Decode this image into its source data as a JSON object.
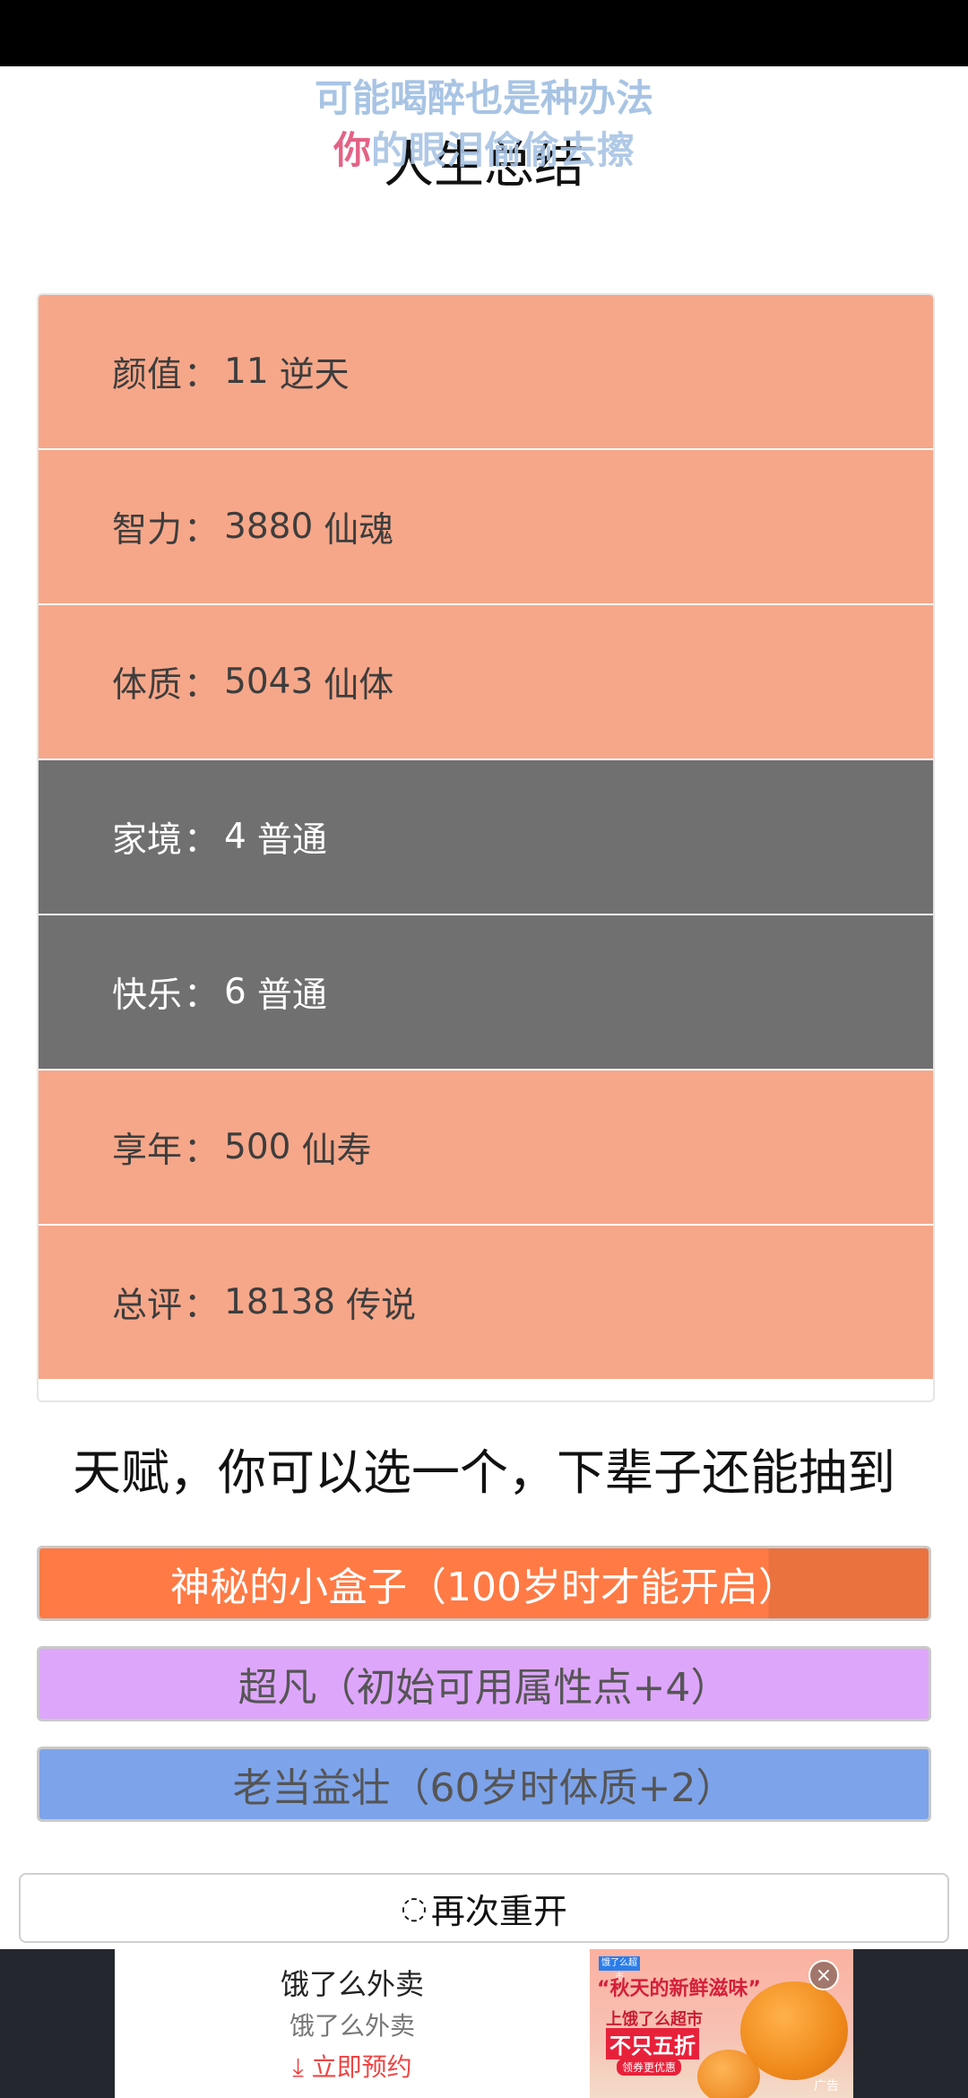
{
  "header": {
    "title": "人生总结",
    "lyrics": {
      "line1": "可能喝醉也是种办法",
      "line2_highlight": "你",
      "line2_rest": "的眼泪偷偷去擦"
    }
  },
  "stats": [
    {
      "name": "颜值",
      "value": "11",
      "level": "逆天",
      "tier": "good"
    },
    {
      "name": "智力",
      "value": "3880",
      "level": "仙魂",
      "tier": "good"
    },
    {
      "name": "体质",
      "value": "5043",
      "level": "仙体",
      "tier": "good"
    },
    {
      "name": "家境",
      "value": "4",
      "level": "普通",
      "tier": "normal"
    },
    {
      "name": "快乐",
      "value": "6",
      "level": "普通",
      "tier": "normal"
    },
    {
      "name": "享年",
      "value": "500",
      "level": "仙寿",
      "tier": "good"
    },
    {
      "name": "总评",
      "value": "18138",
      "level": "传说",
      "tier": "good"
    }
  ],
  "stat_separator": "：",
  "talents": {
    "heading": "天赋，你可以选一个，下辈子还能抽到",
    "options": [
      {
        "label": "神秘的小盒子（100岁时才能开启）",
        "color": "#ff7a45"
      },
      {
        "label": "超凡（初始可用属性点+4）",
        "color": "#dea6fb"
      },
      {
        "label": "老当益壮（60岁时体质+2）",
        "color": "#7da3ea"
      }
    ]
  },
  "restart": {
    "icon": "refresh-icon",
    "label": "再次重开"
  },
  "ad": {
    "title": "饿了么外卖",
    "subtitle": "饿了么外卖",
    "cta_icon": "download-arrow-icon",
    "cta": "立即预约",
    "image": {
      "badge": "饿了么超市",
      "headline": "“秋天的新鲜滋味”",
      "line1": "上饿了么超市",
      "line2": "不只五折",
      "line3": "领券更优惠"
    },
    "label": "广告"
  }
}
